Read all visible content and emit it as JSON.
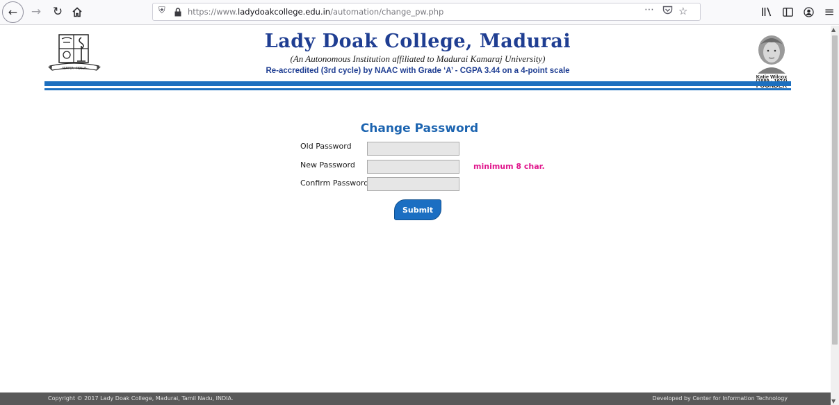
{
  "browser": {
    "url_prefix": "https://www.",
    "url_domain": "ladydoakcollege.edu.in",
    "url_path": "/automation/change_pw.php"
  },
  "header": {
    "title": "Lady Doak College, Madurai",
    "subtitle": "(An Autonomous Institution affiliated to Madurai Kamaraj University)",
    "accreditation": "Re-accredited (3rd cycle) by NAAC with Grade ‘A’ - CGPA 3.44 on a 4-point scale",
    "founder_name": "Katie Wilcox",
    "founder_years": "(1889 - 1974)",
    "founder_label": "FOUNDER"
  },
  "form": {
    "title": "Change Password",
    "old_label": "Old Password",
    "new_label": "New Password",
    "confirm_label": "Confirm Password",
    "old_value": "",
    "new_value": "",
    "confirm_value": "",
    "hint": "minimum 8 char.",
    "submit_label": "Submit"
  },
  "footer": {
    "copyright": "Copyright © 2017 Lady Doak College, Madurai, Tamil Nadu, INDIA.",
    "developer": "Developed by Center for Information Technology"
  },
  "colors": {
    "brand_blue": "#1c6fbf",
    "hint_pink": "#e0168c"
  }
}
